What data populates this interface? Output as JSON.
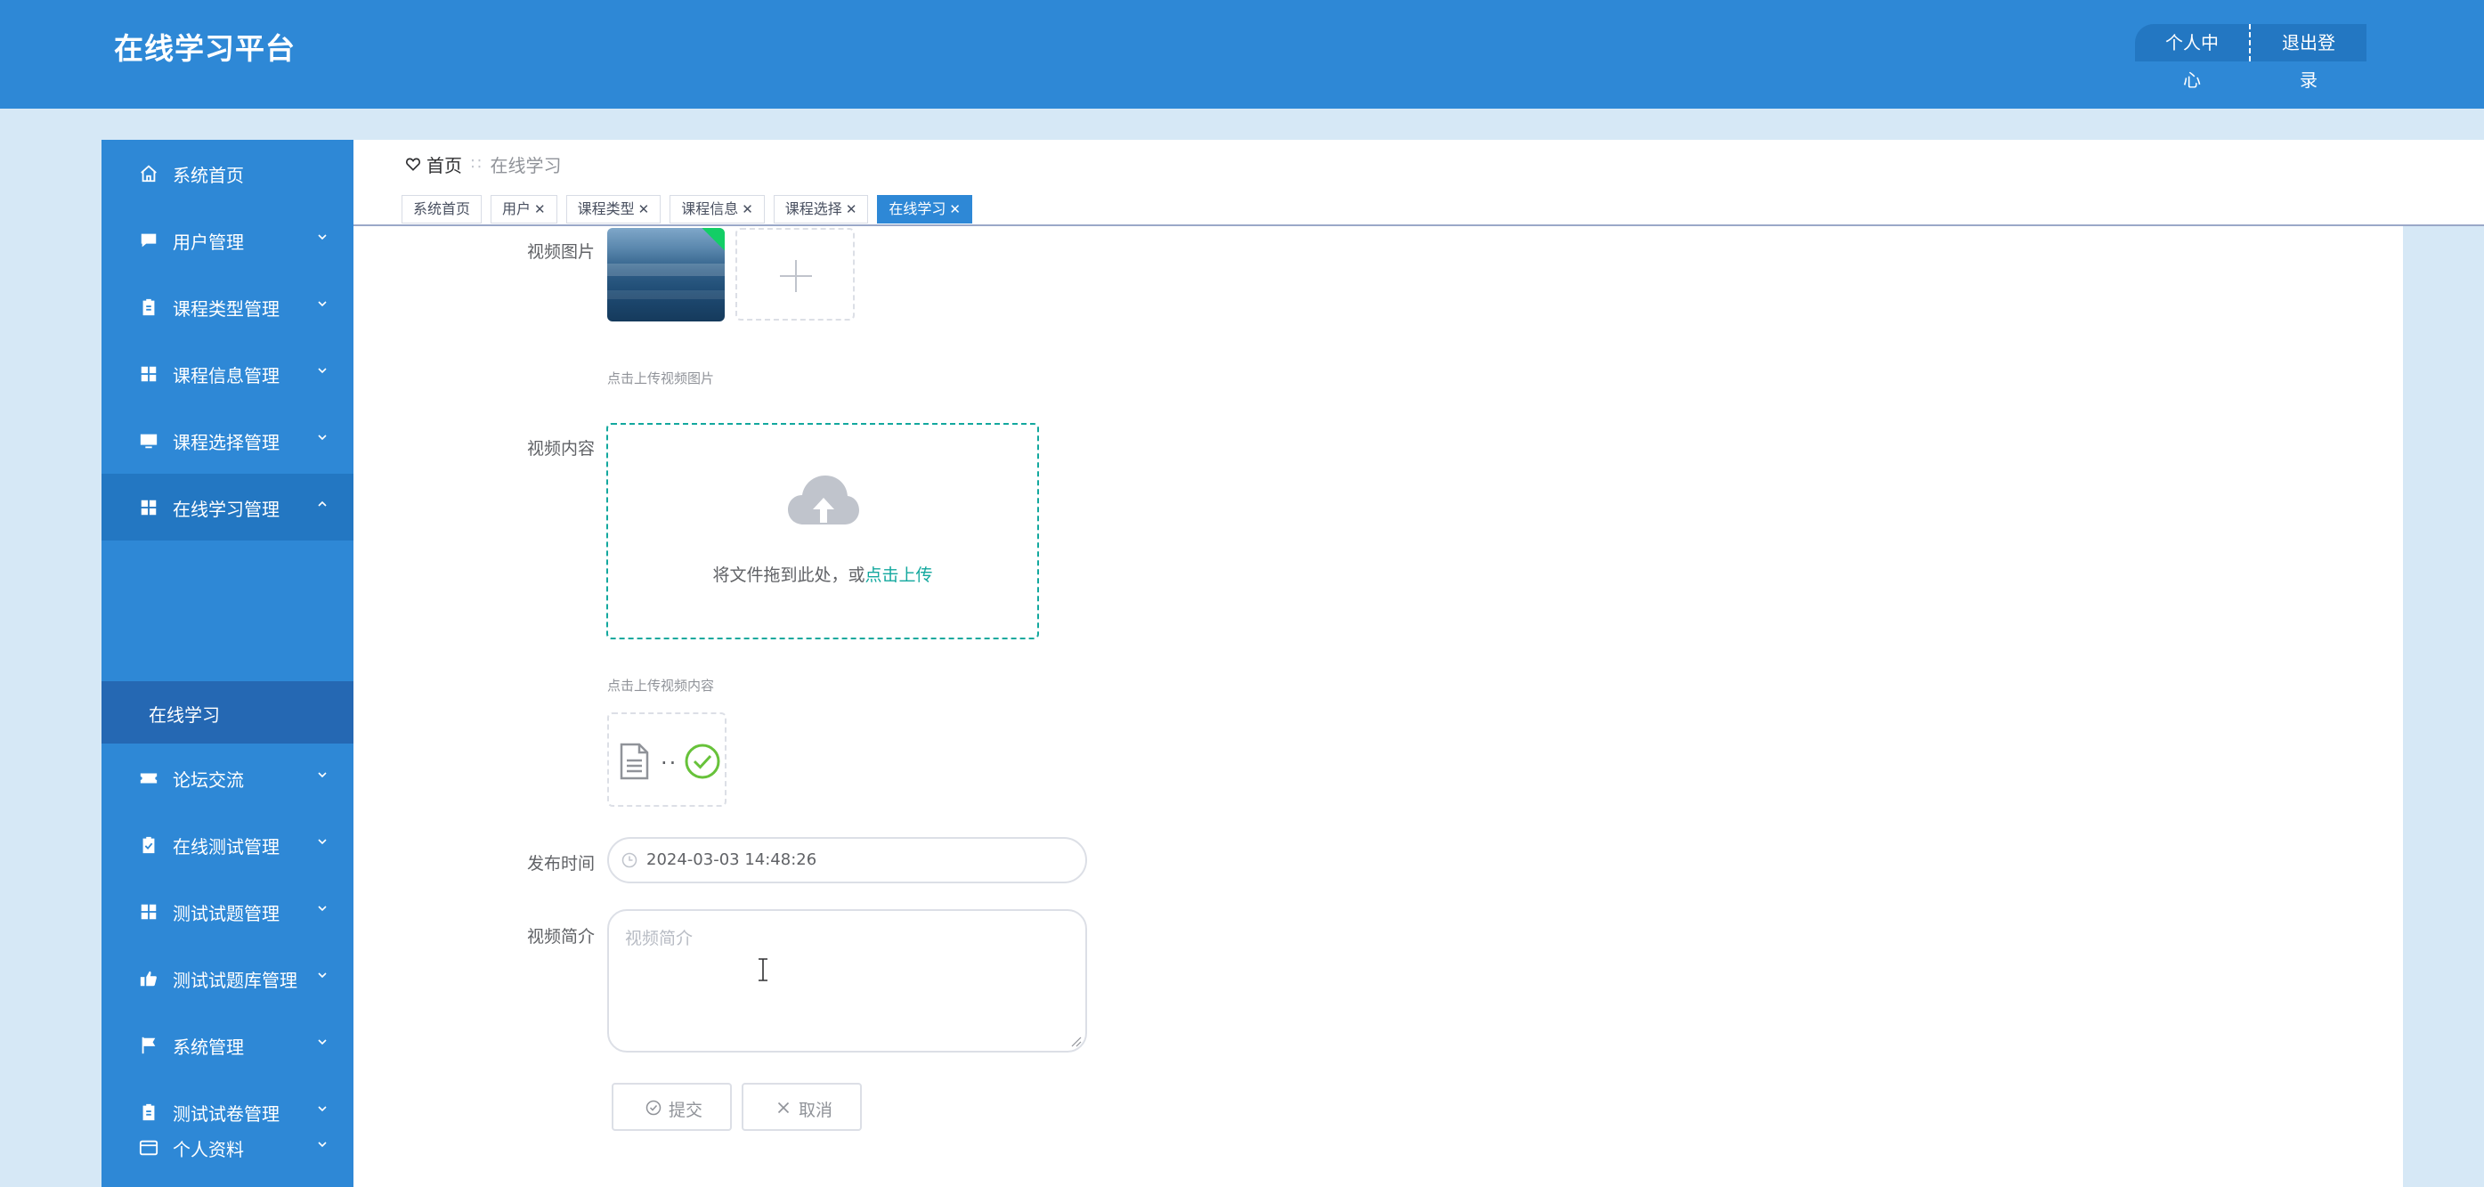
{
  "header": {
    "app_title": "在线学习平台",
    "personal_center": "个人中心",
    "logout": "退出登录"
  },
  "sidebar": {
    "items": [
      {
        "label": "系统首页",
        "icon": "home-icon"
      },
      {
        "label": "用户管理",
        "icon": "chat-icon"
      },
      {
        "label": "课程类型管理",
        "icon": "clipboard-icon"
      },
      {
        "label": "课程信息管理",
        "icon": "grid-icon"
      },
      {
        "label": "课程选择管理",
        "icon": "monitor-icon"
      },
      {
        "label": "在线学习管理",
        "icon": "grid-icon"
      },
      {
        "label": "论坛交流",
        "icon": "ticket-icon"
      },
      {
        "label": "在线测试管理",
        "icon": "clipboard-check-icon"
      },
      {
        "label": "测试试题管理",
        "icon": "grid-icon"
      },
      {
        "label": "测试试题库管理",
        "icon": "thumbs-up-icon"
      },
      {
        "label": "系统管理",
        "icon": "flag-icon"
      },
      {
        "label": "测试试卷管理",
        "icon": "clipboard-icon"
      },
      {
        "label": "个人资料",
        "icon": "card-icon"
      }
    ],
    "submenu_item": "在线学习"
  },
  "breadcrumb": {
    "home": "首页",
    "separator": "∷",
    "current": "在线学习"
  },
  "tabs": [
    {
      "label": "系统首页"
    },
    {
      "label": "用户"
    },
    {
      "label": "课程类型"
    },
    {
      "label": "课程信息"
    },
    {
      "label": "课程选择"
    },
    {
      "label": "在线学习"
    }
  ],
  "form": {
    "video_image_label": "视频图片",
    "video_image_hint": "点击上传视频图片",
    "video_content_label": "视频内容",
    "dragger_text": "将文件拖到此处，或",
    "dragger_link": "点击上传",
    "video_content_hint": "点击上传视频内容",
    "file_name_truncated": "..",
    "publish_time_label": "发布时间",
    "publish_time_value": "2024-03-03 14:48:26",
    "video_intro_label": "视频简介",
    "video_intro_placeholder": "视频简介",
    "submit_label": "提交",
    "cancel_label": "取消"
  },
  "colors": {
    "primary": "#2e88d6",
    "primary_dark": "#2377c2",
    "background": "#d6e8f6",
    "accent_teal": "#13a89e",
    "success": "#13ce66"
  }
}
